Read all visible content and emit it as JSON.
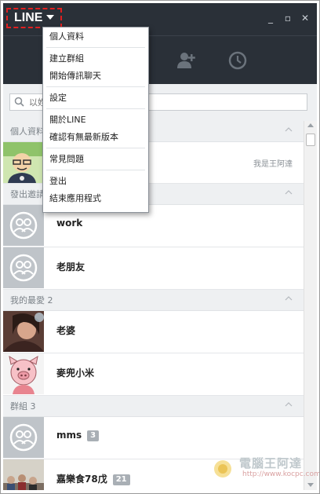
{
  "app": {
    "brand": "LINE",
    "window_buttons": [
      "_",
      "▫",
      "✕"
    ]
  },
  "nav": {
    "icons": [
      "add-friend-icon",
      "history-clock-icon"
    ]
  },
  "search": {
    "placeholder": "以姓"
  },
  "menu": {
    "items": [
      "個人資料",
      "建立群組",
      "開始傳訊聊天",
      "設定",
      "關於LINE",
      "確認有無最新版本",
      "常見問題",
      "登出",
      "結束應用程式"
    ]
  },
  "sections": [
    {
      "label": "個人資料"
    },
    {
      "label": "發出邀請"
    },
    {
      "label": "我的最愛 2"
    },
    {
      "label": "群組 3"
    }
  ],
  "profile": {
    "status": "我是王阿達"
  },
  "invites": [
    {
      "name": "work"
    },
    {
      "name": "老朋友"
    }
  ],
  "favorites": [
    {
      "name": "老婆"
    },
    {
      "name": "麥兜小米"
    }
  ],
  "groups": [
    {
      "name": "mms",
      "count": "3"
    },
    {
      "name": "嘉樂食78戊",
      "count": "21"
    }
  ],
  "watermark": {
    "title": "電腦王阿達",
    "url": "http://www.kocpc.com.tw"
  },
  "colors": {
    "titlebar": "#2a3038",
    "highlight": "#e02020",
    "section_bg": "#eef0f2"
  }
}
